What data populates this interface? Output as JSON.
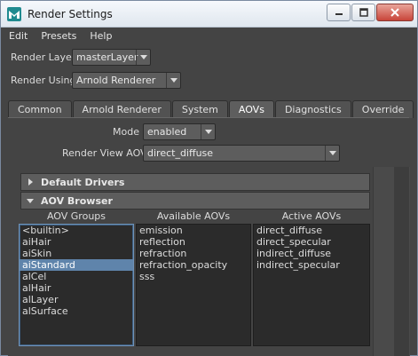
{
  "window": {
    "title": "Render Settings"
  },
  "menu": [
    "Edit",
    "Presets",
    "Help"
  ],
  "render_layer": {
    "label": "Render Layer",
    "value": "masterLayer"
  },
  "render_using": {
    "label": "Render Using",
    "value": "Arnold Renderer"
  },
  "tabs": [
    {
      "label": "Common",
      "active": false
    },
    {
      "label": "Arnold Renderer",
      "active": false
    },
    {
      "label": "System",
      "active": false
    },
    {
      "label": "AOVs",
      "active": true
    },
    {
      "label": "Diagnostics",
      "active": false
    },
    {
      "label": "Override",
      "active": false
    }
  ],
  "mode": {
    "label": "Mode",
    "value": "enabled"
  },
  "render_view_aov": {
    "label": "Render View AOV",
    "value": "direct_diffuse"
  },
  "sections": {
    "default_drivers": "Default Drivers",
    "aov_browser": "AOV Browser"
  },
  "aov_groups": {
    "header": "AOV Groups",
    "items": [
      "<builtin>",
      "aiHair",
      "aiSkin",
      "aiStandard",
      "alCel",
      "alHair",
      "alLayer",
      "alSurface"
    ],
    "selected": "aiStandard"
  },
  "available_aovs": {
    "header": "Available AOVs",
    "items": [
      "emission",
      "reflection",
      "refraction",
      "refraction_opacity",
      "sss"
    ]
  },
  "active_aovs": {
    "header": "Active AOVs",
    "items": [
      "direct_diffuse",
      "direct_specular",
      "indirect_diffuse",
      "indirect_specular"
    ]
  }
}
